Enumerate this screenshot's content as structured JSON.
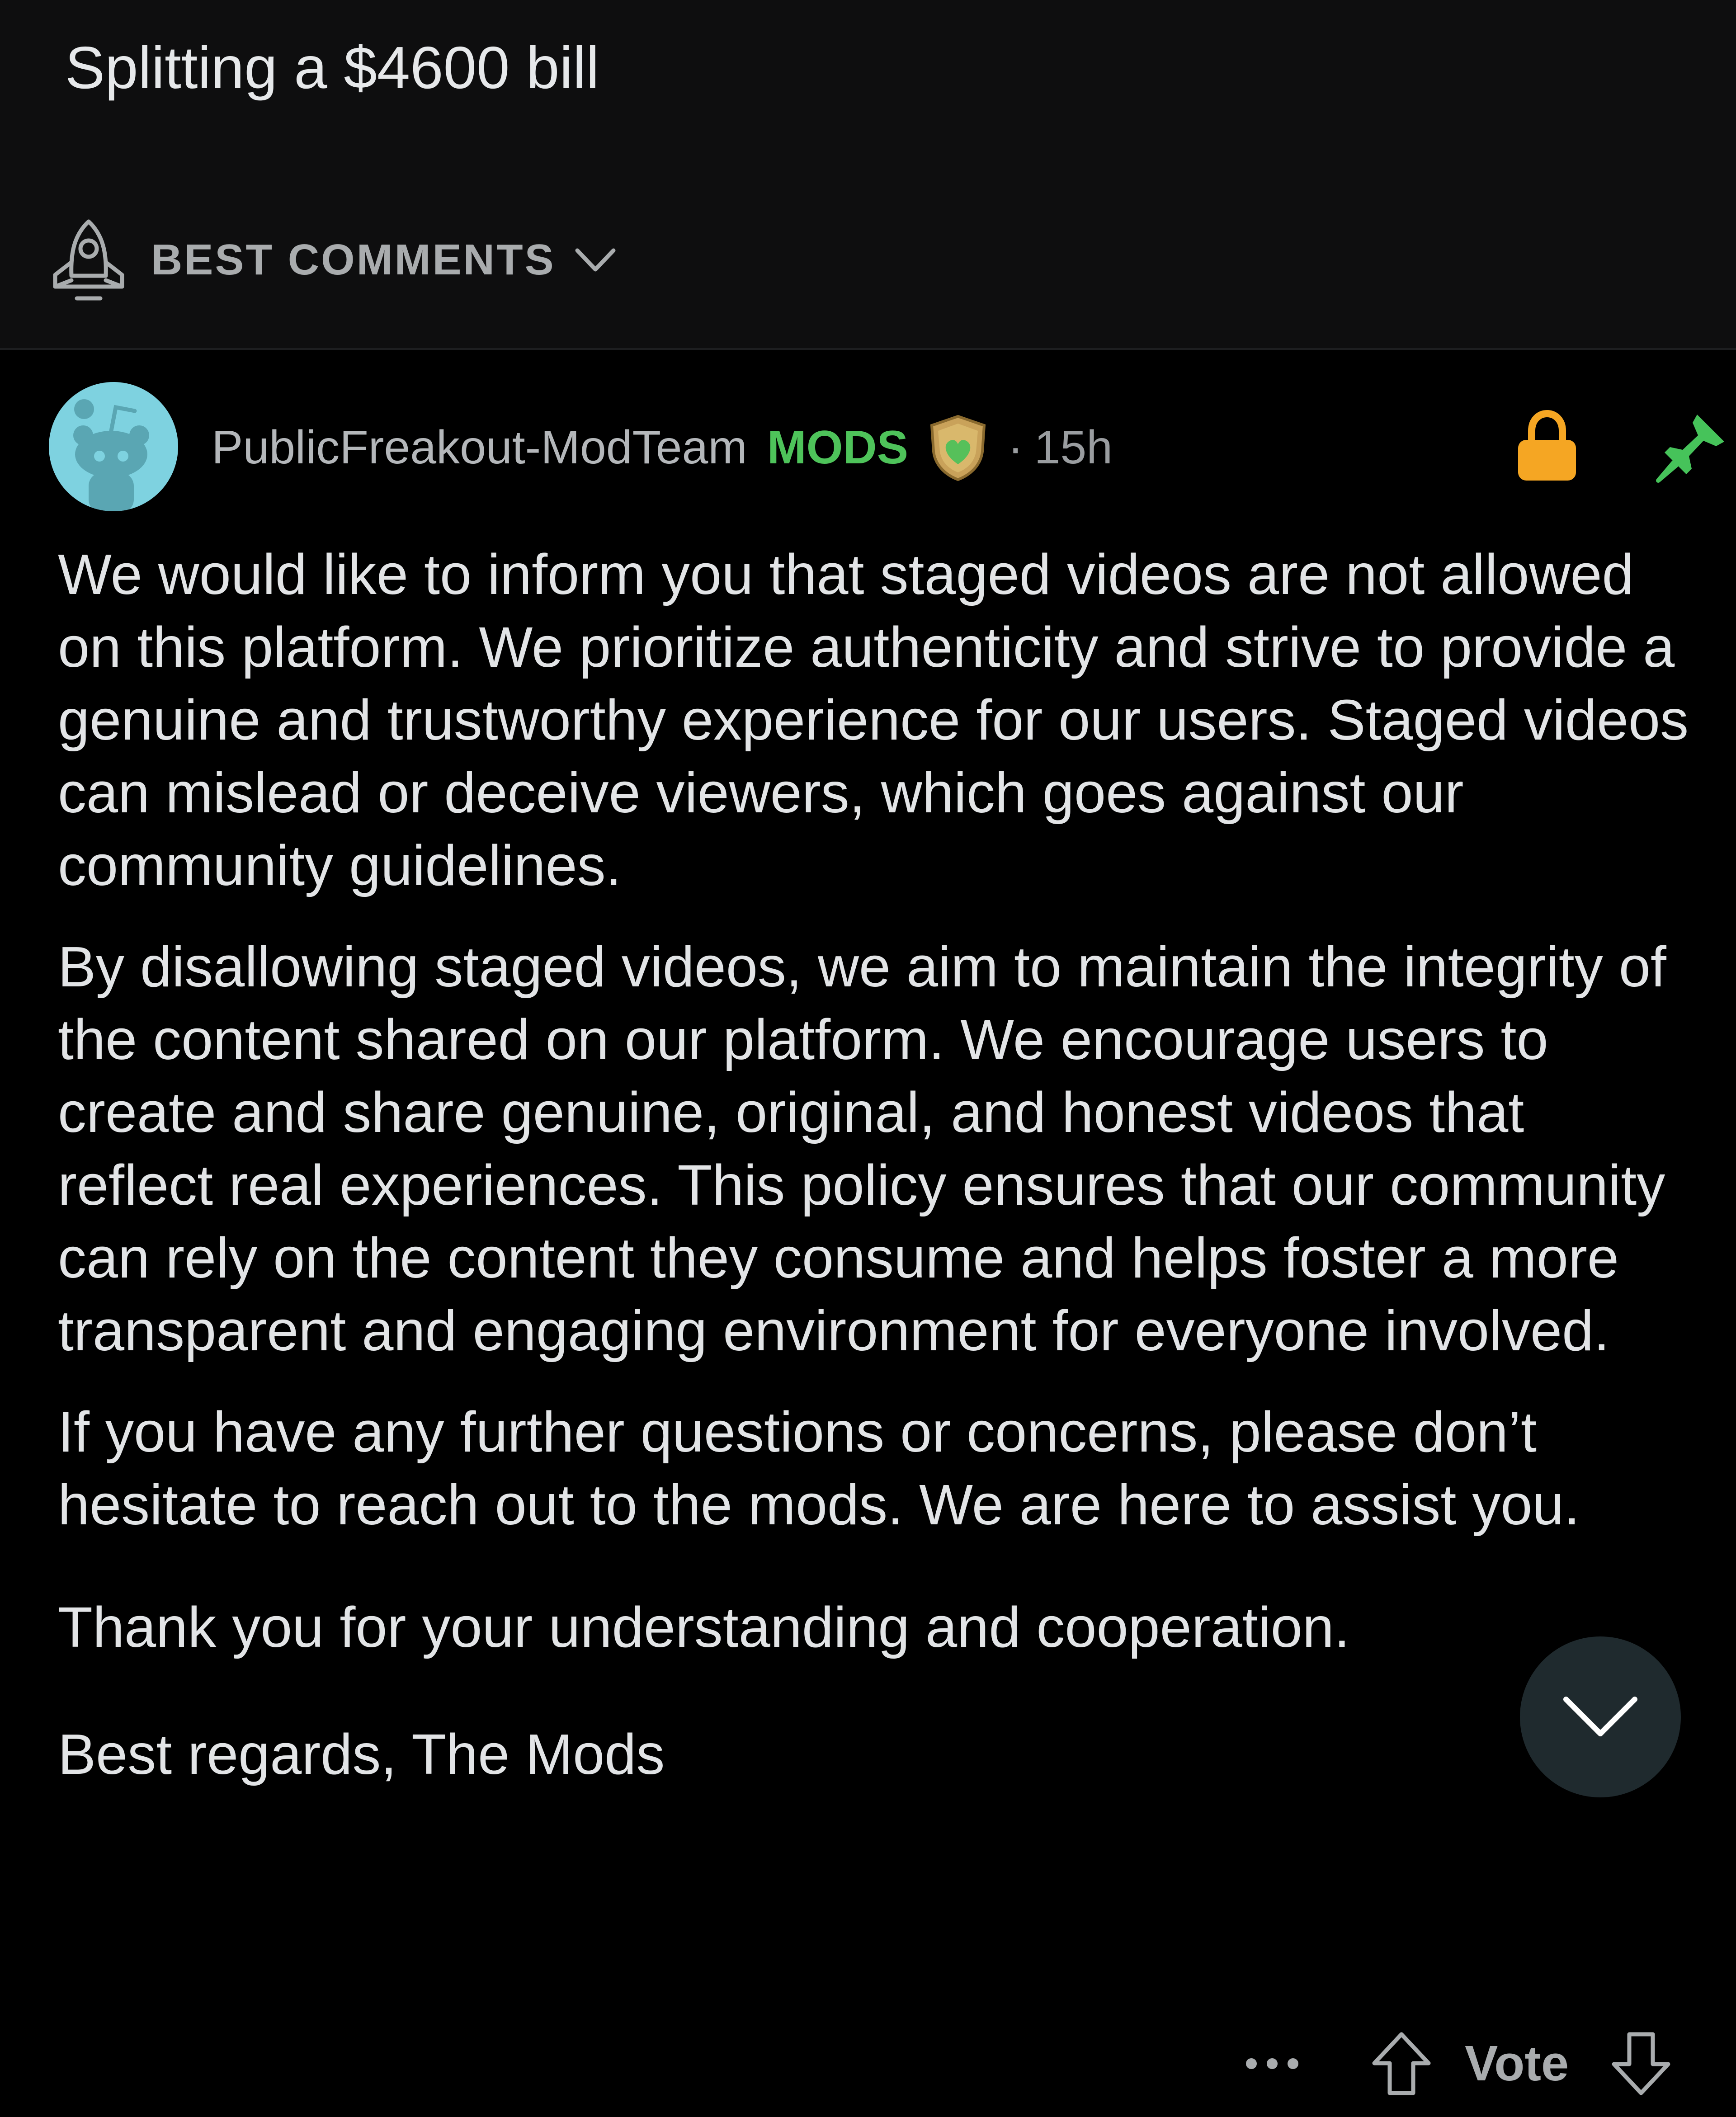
{
  "post": {
    "title": "Splitting a $4600 bill"
  },
  "sort": {
    "label": "BEST COMMENTS",
    "icon": "rocket-icon"
  },
  "comment": {
    "author": "PublicFreakout-ModTeam",
    "flair": "MODS",
    "separator": "·",
    "age": "15h",
    "paragraphs": [
      "We would like to inform you that staged videos are not allowed on this platform. We prioritize authenticity and strive to provide a genuine and trustworthy experience for our users. Staged videos can mislead or deceive viewers, which goes against our community guidelines.",
      "By disallowing staged videos, we aim to maintain the integrity of the content shared on our platform. We encourage users to create and share genuine, original, and honest videos that reflect real experiences. This policy ensures that our community can rely on the content they consume and helps foster a more transparent and engaging environment for everyone involved.",
      "If you have any further questions or concerns, please don’t hesitate to reach out to the mods. We are here to assist you.",
      "Thank you for your understanding and cooperation.",
      "Best regards, The Mods"
    ]
  },
  "actions": {
    "more_label": "···",
    "vote_label": "Vote"
  },
  "colors": {
    "background": "#000000",
    "header_background": "#0e0e0f",
    "mods_green": "#4ec35a",
    "lock_orange": "#f5a623",
    "pin_green": "#46c35a",
    "avatar_bg": "#7ed2e0"
  }
}
